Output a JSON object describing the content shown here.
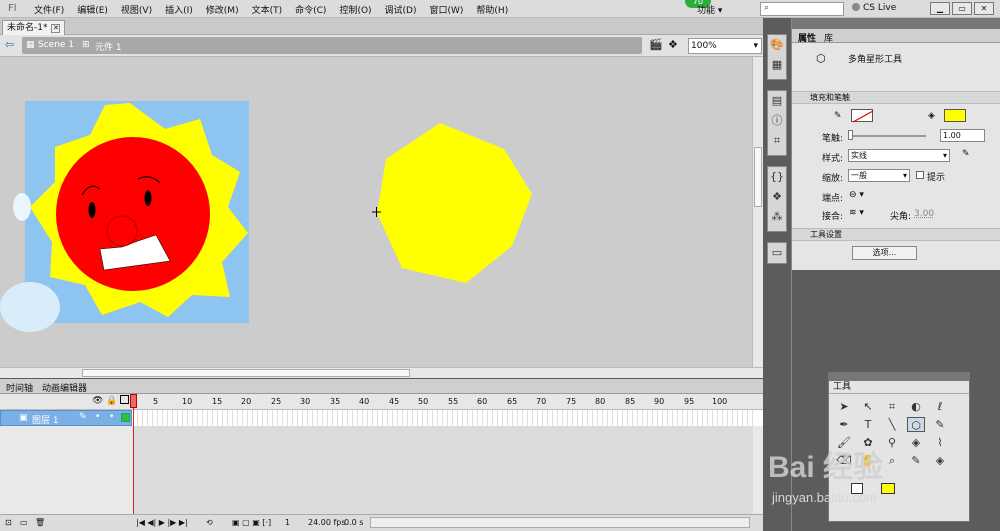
{
  "menubar": {
    "logo": "Fl",
    "items": [
      "文件(F)",
      "编辑(E)",
      "视图(V)",
      "插入(I)",
      "修改(M)",
      "文本(T)",
      "命令(C)",
      "控制(O)",
      "调试(D)",
      "窗口(W)",
      "帮助(H)"
    ],
    "badge": "70",
    "workspace": "功能 ▾",
    "cslive": "CS Live"
  },
  "doc": {
    "tab_title": "未命名-1*",
    "scene": "Scene 1",
    "symbol": "元件 1",
    "zoom": "100%"
  },
  "timeline": {
    "tabs": [
      "时间轴",
      "动画编辑器"
    ],
    "frame_numbers": [
      "1",
      "5",
      "10",
      "15",
      "20",
      "25",
      "30",
      "35",
      "40",
      "45",
      "50",
      "55",
      "60",
      "65",
      "70",
      "75",
      "80",
      "85",
      "90",
      "95",
      "100"
    ],
    "layer_name": "图层 1",
    "current_frame": "1",
    "fps": "24.00 fps",
    "time": "0.0 s"
  },
  "properties": {
    "tabs": [
      "属性",
      "库"
    ],
    "tool_name": "多角星形工具",
    "fill_stroke_section": "填充和笔触",
    "stroke_label": "笔触:",
    "stroke_value": "1.00",
    "style_label": "样式:",
    "style_value": "实线",
    "scale_label": "缩放:",
    "scale_value": "一般",
    "hint_label": "提示",
    "cap_label": "端点:",
    "join_label": "接合:",
    "miter_label": "尖角:",
    "miter_value": "3.00",
    "tool_settings_section": "工具设置",
    "options_button": "选项...",
    "fill_color": "#ffff00",
    "stroke_color": "none"
  },
  "tools_panel": {
    "title": "工具"
  },
  "watermark": {
    "brand": "Bai 经验",
    "url": "jingyan.baidu.com"
  },
  "colors": {
    "sun_fill": "#ffff00",
    "face_fill": "#ff0000",
    "sky": "#8ec4f0"
  }
}
